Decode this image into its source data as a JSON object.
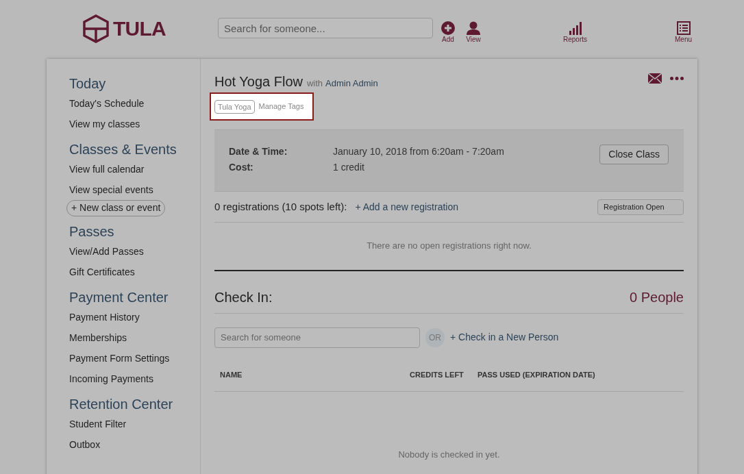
{
  "header": {
    "logo": "TULA",
    "search": {
      "placeholder": "Search for someone..."
    },
    "actions": [
      {
        "label": "Add",
        "kind": "add"
      },
      {
        "label": "View",
        "kind": "person"
      }
    ],
    "right_actions": [
      {
        "label": "Reports",
        "kind": "reports"
      },
      {
        "label": "Menu",
        "kind": "menu"
      }
    ]
  },
  "sidebar": {
    "sections": [
      {
        "title": "Today",
        "items": [
          {
            "label": "Today's Schedule",
            "kind": "link"
          },
          {
            "label": "View my classes",
            "kind": "link"
          }
        ]
      },
      {
        "title": "Classes & Events",
        "items": [
          {
            "label": "View full calendar",
            "kind": "link"
          },
          {
            "label": "View special events",
            "kind": "link"
          },
          {
            "label": "+ New class or event",
            "kind": "pill"
          }
        ]
      },
      {
        "title": "Passes",
        "items": [
          {
            "label": "View/Add Passes",
            "kind": "link"
          },
          {
            "label": "Gift Certificates",
            "kind": "link"
          }
        ]
      },
      {
        "title": "Payment Center",
        "items": [
          {
            "label": "Payment History",
            "kind": "link"
          },
          {
            "label": "Memberships",
            "kind": "link"
          },
          {
            "label": "Payment Form Settings",
            "kind": "link"
          },
          {
            "label": "Incoming Payments",
            "kind": "link"
          }
        ]
      },
      {
        "title": "Retention Center",
        "items": [
          {
            "label": "Student Filter",
            "kind": "link"
          },
          {
            "label": "Outbox",
            "kind": "link"
          }
        ]
      }
    ]
  },
  "class": {
    "title": "Hot Yoga Flow",
    "with": "with",
    "instructor": "Admin Admin",
    "tags": [
      "Tula Yoga"
    ],
    "manage_tags": "Manage Tags",
    "tags_highlighted": true,
    "details": [
      {
        "label": "Date & Time:",
        "value": "January 10, 2018 from 6:20am - 7:20am"
      },
      {
        "label": "Cost:",
        "value": "1 credit"
      }
    ],
    "close_button": "Close Class"
  },
  "registrations": {
    "summary": "0 registrations (10 spots left):",
    "add_link": "+ Add a new registration",
    "status_button": "Registration Open",
    "empty": "There are no open registrations right now."
  },
  "check_in": {
    "title": "Check In:",
    "count": "0 People",
    "search": {
      "placeholder": "Search for someone"
    },
    "or": "OR",
    "new_person_link": "+ Check in a New Person",
    "table": {
      "columns": [
        "NAME",
        "CREDITS LEFT",
        "PASS USED (EXPIRATION DATE)"
      ]
    },
    "empty": "Nobody is checked in yet."
  }
}
